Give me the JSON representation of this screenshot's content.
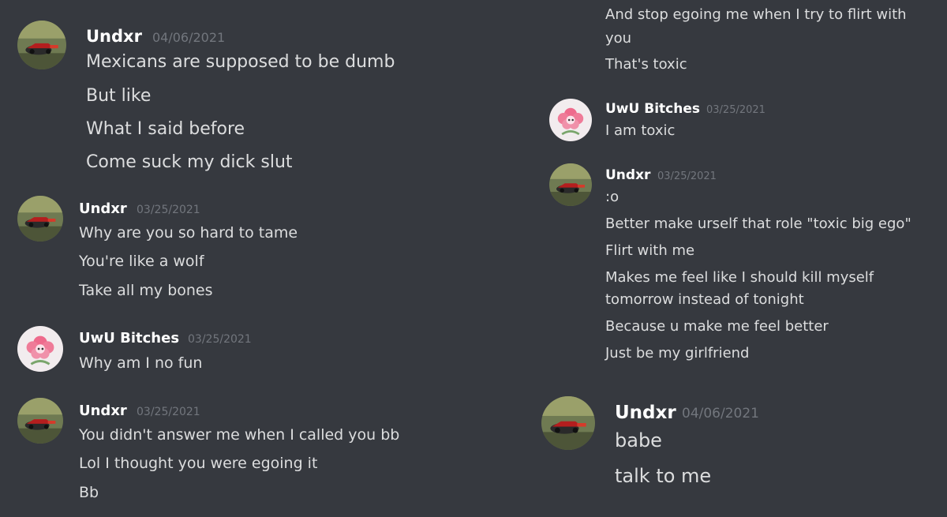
{
  "left": {
    "groups": [
      {
        "author": "Undxr",
        "timestamp": "04/06/2021",
        "avatar": "rocket-car-icon",
        "lines": [
          "Mexicans are supposed to be dumb",
          "But like",
          "What I said before",
          "Come suck my dick slut"
        ]
      },
      {
        "author": "Undxr",
        "timestamp": "03/25/2021",
        "avatar": "rocket-car-icon",
        "lines": [
          "Why are you so hard to tame",
          "You're like a wolf",
          "Take all my bones"
        ]
      },
      {
        "author": "UwU Bitches",
        "timestamp": "03/25/2021",
        "avatar": "pink-flower-icon",
        "lines": [
          "Why am I no fun"
        ]
      },
      {
        "author": "Undxr",
        "timestamp": "03/25/2021",
        "avatar": "rocket-car-icon",
        "lines": [
          "You didn't answer me when I called you bb",
          "Lol I thought you were egoing it",
          "Bb"
        ]
      }
    ]
  },
  "right": {
    "continuation_lines": [
      "And stop egoing me when I try to flirt with",
      "you",
      "That's toxic"
    ],
    "groups": [
      {
        "author": "UwU Bitches",
        "timestamp": "03/25/2021",
        "avatar": "pink-flower-icon",
        "lines": [
          "I am toxic"
        ]
      },
      {
        "author": "Undxr",
        "timestamp": "03/25/2021",
        "avatar": "rocket-car-icon",
        "lines": [
          ":o",
          "Better make urself that role \"toxic big ego\"",
          "Flirt with me",
          "Makes me feel like I should kill myself",
          "tomorrow instead of tonight",
          "Because u make me feel better",
          "Just be my girlfriend"
        ]
      },
      {
        "author": "Undxr",
        "timestamp": "04/06/2021",
        "avatar": "rocket-car-icon",
        "lines": [
          "babe",
          "talk to me"
        ]
      }
    ]
  },
  "colors": {
    "background": "#36393f",
    "username": "#ffffff",
    "timestamp": "#72767d",
    "text": "#dcddde"
  }
}
